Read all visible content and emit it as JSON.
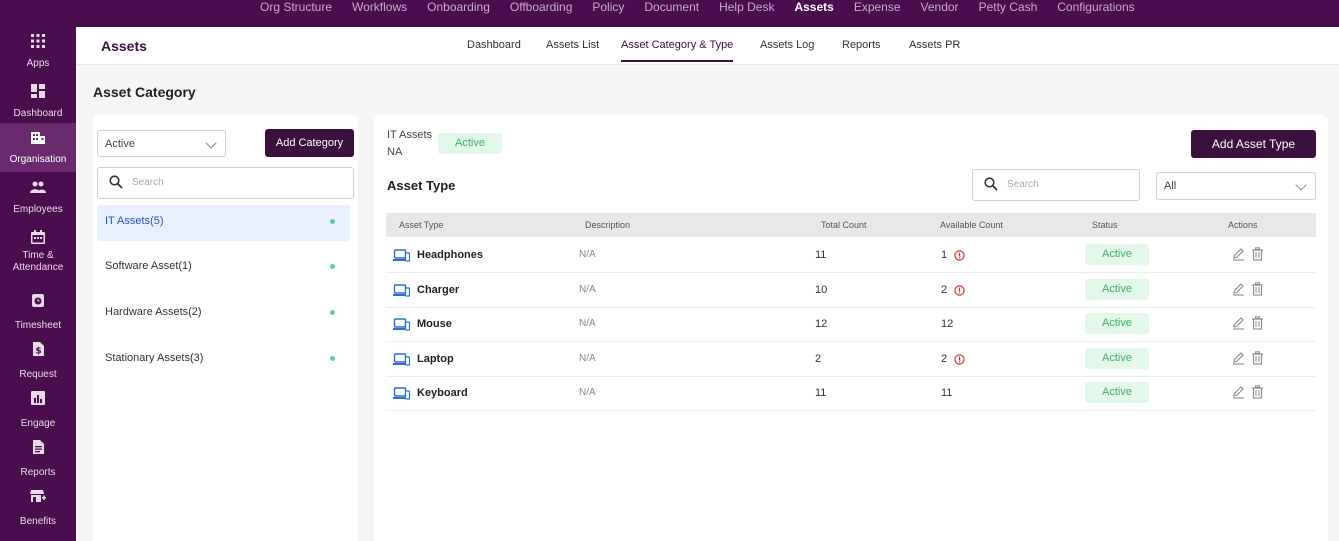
{
  "topnav": [
    {
      "label": "Org Structure",
      "active": false
    },
    {
      "label": "Workflows",
      "active": false
    },
    {
      "label": "Onboarding",
      "active": false
    },
    {
      "label": "Offboarding",
      "active": false
    },
    {
      "label": "Policy",
      "active": false
    },
    {
      "label": "Document",
      "active": false
    },
    {
      "label": "Help Desk",
      "active": false
    },
    {
      "label": "Assets",
      "active": true
    },
    {
      "label": "Expense",
      "active": false
    },
    {
      "label": "Vendor",
      "active": false
    },
    {
      "label": "Petty Cash",
      "active": false
    },
    {
      "label": "Configurations",
      "active": false
    }
  ],
  "sidebar": {
    "items": [
      {
        "label": "Apps",
        "icon": "apps-icon"
      },
      {
        "label": "Dashboard",
        "icon": "dashboard-icon"
      },
      {
        "label": "Organisation",
        "icon": "organisation-icon",
        "active": true
      },
      {
        "label": "Employees",
        "icon": "employees-icon"
      },
      {
        "label": "Time &",
        "label2": "Attendance",
        "icon": "calendar-icon"
      },
      {
        "label": "Timesheet",
        "icon": "timesheet-icon"
      },
      {
        "label": "Request",
        "icon": "request-icon"
      },
      {
        "label": "Engage",
        "icon": "engage-icon"
      },
      {
        "label": "Reports",
        "icon": "reports-icon"
      },
      {
        "label": "Benefits",
        "icon": "benefits-icon"
      }
    ]
  },
  "header": {
    "title": "Assets",
    "tabs": [
      {
        "label": "Dashboard"
      },
      {
        "label": "Assets List"
      },
      {
        "label": "Asset Category & Type",
        "active": true
      },
      {
        "label": "Assets Log"
      },
      {
        "label": "Reports"
      },
      {
        "label": "Assets PR"
      }
    ]
  },
  "page_title": "Asset Category",
  "left": {
    "status_select": "Active",
    "add_category_label": "Add Category",
    "search_placeholder": "Search",
    "categories": [
      {
        "name": "IT Assets(5)",
        "active": true
      },
      {
        "name": "Software Asset(1)"
      },
      {
        "name": "Hardware Assets(2)"
      },
      {
        "name": "Stationary Assets(3)"
      }
    ]
  },
  "right": {
    "category_name": "IT Assets",
    "category_desc": "NA",
    "category_status": "Active",
    "add_type_label": "Add Asset Type",
    "section_title": "Asset Type",
    "search_placeholder": "Search",
    "filter_select": "All",
    "columns": [
      "Asset Type",
      "Description",
      "Total Count",
      "Available Count",
      "Status",
      "Actions"
    ],
    "rows": [
      {
        "type": "Headphones",
        "description": "N/A",
        "total": "11",
        "available": "1",
        "low": true,
        "status": "Active"
      },
      {
        "type": "Charger",
        "description": "N/A",
        "total": "10",
        "available": "2",
        "low": true,
        "status": "Active"
      },
      {
        "type": "Mouse",
        "description": "N/A",
        "total": "12",
        "available": "12",
        "low": false,
        "status": "Active"
      },
      {
        "type": "Laptop",
        "description": "N/A",
        "total": "2",
        "available": "2",
        "low": true,
        "status": "Active"
      },
      {
        "type": "Keyboard",
        "description": "N/A",
        "total": "11",
        "available": "11",
        "low": false,
        "status": "Active"
      }
    ]
  },
  "colors": {
    "brand": "#4a0d4e",
    "primary_button": "#3b0f3e",
    "active_badge_bg": "#e3f7ea",
    "active_badge_text": "#3bb26a",
    "warning": "#d9302c",
    "device_icon": "#2f6fd0"
  }
}
